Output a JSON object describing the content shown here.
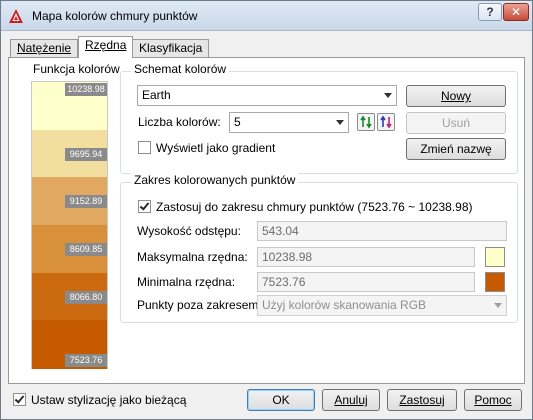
{
  "window": {
    "title": "Mapa kolorów chmury punktów",
    "help_symbol": "?",
    "close_symbol": "✕"
  },
  "tabs": [
    {
      "label": "Natężenie"
    },
    {
      "label": "Rzędna"
    },
    {
      "label": "Klasyfikacja"
    }
  ],
  "color_function": {
    "title": "Funkcja kolorów",
    "bands": [
      {
        "color": "#ffffcc",
        "label": "10238.98"
      },
      {
        "color": "#f2dfa0",
        "label": "9695.94"
      },
      {
        "color": "#e0a860",
        "label": "9152.89"
      },
      {
        "color": "#d9903a",
        "label": "8609.85"
      },
      {
        "color": "#cc6a12",
        "label": "8066.80"
      },
      {
        "color": "#c55a00",
        "label": "7523.76"
      }
    ]
  },
  "scheme": {
    "group_title": "Schemat kolorów",
    "selected_scheme": "Earth",
    "new_button": "Nowy",
    "color_count_label": "Liczba kolorów:",
    "color_count_value": "5",
    "delete_button": "Usuń",
    "gradient_checkbox_label": "Wyświetl jako gradient",
    "gradient_checked": false,
    "rename_button": "Zmień nazwę"
  },
  "range": {
    "group_title": "Zakres kolorowanych punktów",
    "apply_checkbox_label": "Zastosuj do zakresu chmury punktów  (7523.76 ~ 10238.98)",
    "apply_checked": true,
    "spacing_label": "Wysokość odstępu:",
    "spacing_value": "543.04",
    "max_label": "Maksymalna rzędna:",
    "max_value": "10238.98",
    "max_color": "#ffffcc",
    "min_label": "Minimalna rzędna:",
    "min_value": "7523.76",
    "min_color": "#c55a00",
    "outside_label": "Punkty poza zakresem:",
    "outside_value": "Użyj kolorów skanowania RGB"
  },
  "footer": {
    "set_current_label": "Ustaw stylizację jako bieżącą",
    "set_current_checked": true,
    "ok": "OK",
    "cancel": "Anuluj",
    "apply": "Zastosuj",
    "help": "Pomoc"
  }
}
